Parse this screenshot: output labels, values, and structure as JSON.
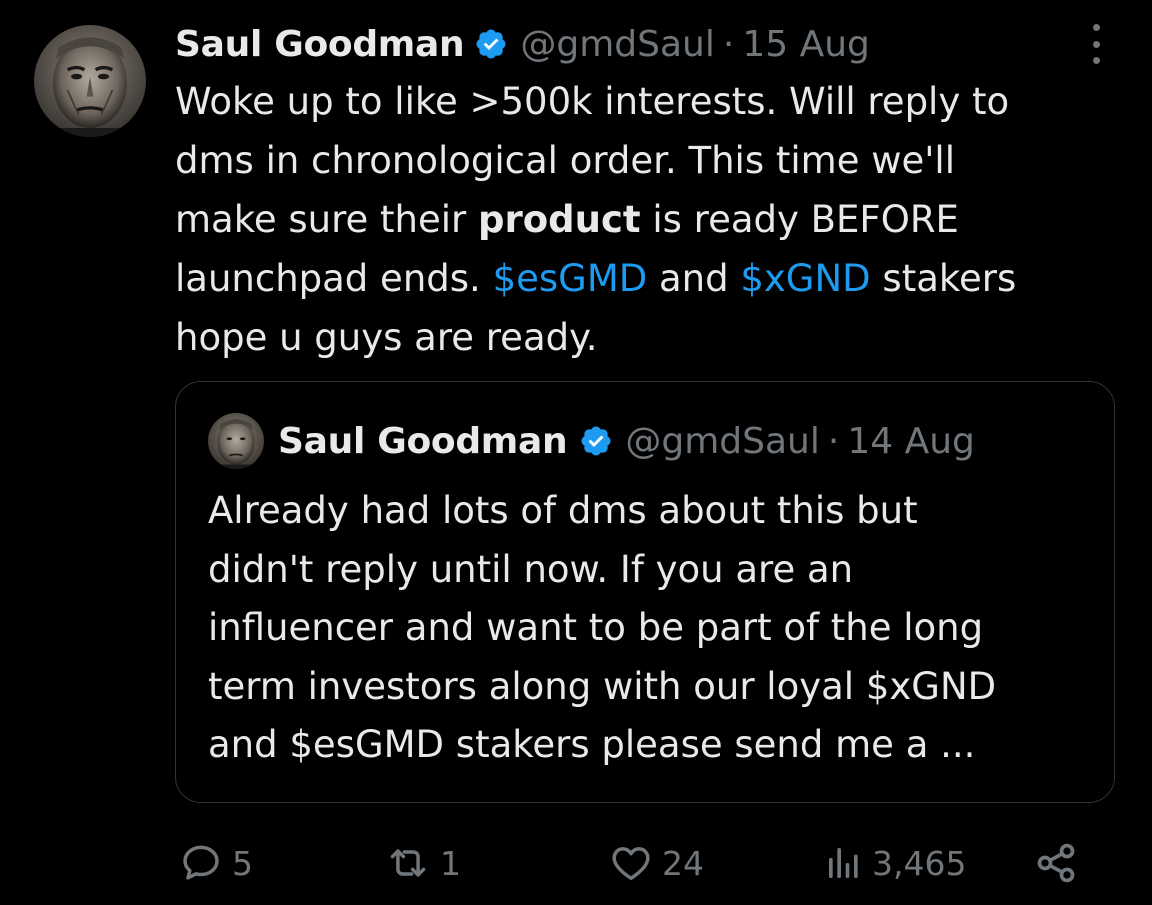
{
  "tweet": {
    "author": {
      "name": "Saul Goodman",
      "handle": "@gmdSaul",
      "separator": "·",
      "date": "15 Aug",
      "avatar_icon": "profile-photo",
      "verified_icon": "verified-badge-icon"
    },
    "text_lines": [
      {
        "plain": "Woke up to like >500k interests. Will reply to"
      },
      {
        "plain": "dms in chronological order. This time we'll"
      },
      {
        "pre": "make sure their ",
        "bold": "product",
        "post": " is ready BEFORE"
      },
      {
        "pre": "launchpad ends. ",
        "tag1": "$esGMD",
        "mid": " and ",
        "tag2": "$xGND",
        "post": " stakers"
      },
      {
        "plain": "hope u guys are ready."
      }
    ],
    "more_icon": "more-options-icon"
  },
  "quoted_tweet": {
    "author": {
      "name": "Saul Goodman",
      "handle": "@gmdSaul",
      "separator": "·",
      "date": "14 Aug"
    },
    "text_lines": [
      "Already had lots of dms about this but",
      "didn't reply until now. If you are an",
      "influencer and want to be part of the long",
      "term investors along with our loyal $xGND",
      "and $esGMD stakers please send me a ..."
    ]
  },
  "actions": {
    "replies": {
      "icon": "reply-icon",
      "count": "5"
    },
    "reposts": {
      "icon": "repost-icon",
      "count": "1"
    },
    "likes": {
      "icon": "like-icon",
      "count": "24"
    },
    "views": {
      "icon": "views-icon",
      "count": "3,465"
    },
    "share": {
      "icon": "share-icon"
    }
  },
  "colors": {
    "background": "#000000",
    "text": "#e7e9ea",
    "secondary": "#71767b",
    "link": "#1d9bf0",
    "verified": "#1d9bf0",
    "border": "#2f3336"
  }
}
